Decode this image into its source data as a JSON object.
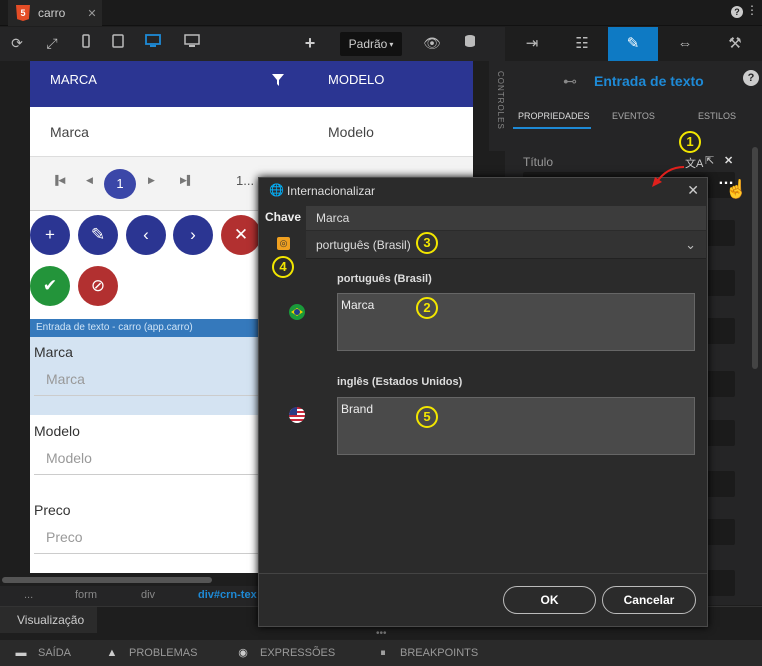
{
  "tab": {
    "title": "carro",
    "close": "✕",
    "icon_text": "5"
  },
  "toolbar": {
    "padrao": "Padrão"
  },
  "right_panel": {
    "title": "Entrada de texto",
    "tabs": [
      "PROPRIEDADES",
      "EVENTOS",
      "ESTILOS"
    ],
    "prop_label": "Título",
    "side_label": "CONTROLES"
  },
  "table": {
    "header_col1": "MARCA",
    "header_col2": "MODELO",
    "cell_col1": "Marca",
    "cell_col2": "Modelo"
  },
  "pager": {
    "current_page": "1",
    "page_size": "1..."
  },
  "selection_bar": "Entrada de texto - carro (app.carro)",
  "form": {
    "fields": [
      {
        "label": "Marca",
        "placeholder": "Marca"
      },
      {
        "label": "Modelo",
        "placeholder": "Modelo"
      },
      {
        "label": "Preco",
        "placeholder": "Preco"
      }
    ]
  },
  "breadcrumb": [
    "...",
    "form",
    "div",
    "div#crn-tex"
  ],
  "bottom_tab": "Visualização",
  "status": [
    "SAÍDA",
    "PROBLEMAS",
    "EXPRESSÕES",
    "BREAKPOINTS"
  ],
  "dialog": {
    "title": "Internacionalizar",
    "key_label": "Chave",
    "key_value": "Marca",
    "selected_language": "português (Brasil)",
    "langs": [
      {
        "name": "português (Brasil)",
        "value": "Marca"
      },
      {
        "name": "inglês (Estados Unidos)",
        "value": "Brand"
      }
    ],
    "ok": "OK",
    "cancel": "Cancelar"
  },
  "callouts": [
    "1",
    "2",
    "3",
    "4",
    "5"
  ],
  "colors": {
    "accent": "#0e7ac4",
    "header_blue": "#2b3592",
    "callout": "#f2e600"
  }
}
